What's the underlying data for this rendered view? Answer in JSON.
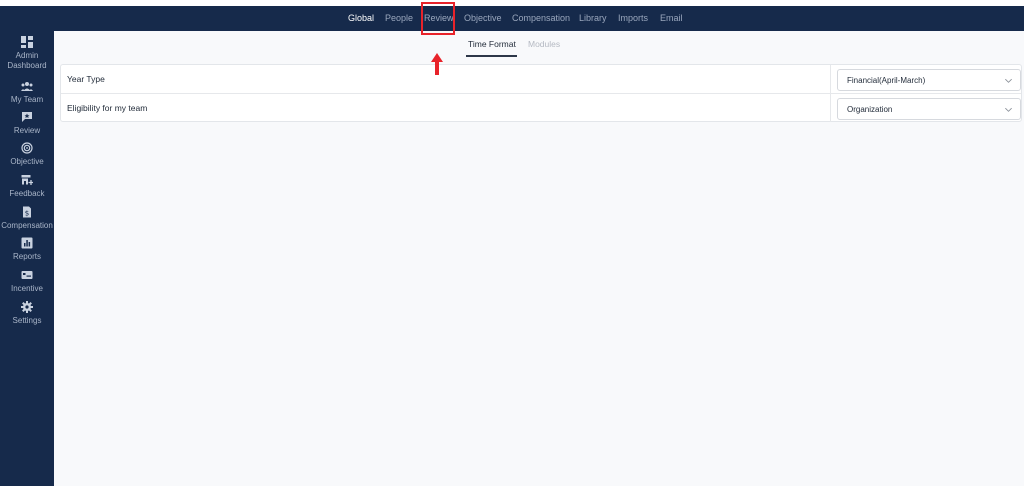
{
  "topnav": {
    "items": [
      {
        "label": "Global",
        "active": true
      },
      {
        "label": "People",
        "active": false
      },
      {
        "label": "Review",
        "active": false
      },
      {
        "label": "Objective",
        "active": false
      },
      {
        "label": "Compensation",
        "active": false
      },
      {
        "label": "Library",
        "active": false
      },
      {
        "label": "Imports",
        "active": false
      },
      {
        "label": "Email",
        "active": false
      }
    ]
  },
  "sidebar": {
    "items": [
      {
        "label": "Admin Dashboard",
        "line1": "Admin",
        "line2": "Dashboard",
        "icon": "dashboard-grid-icon"
      },
      {
        "label": "My Team",
        "icon": "team-icon"
      },
      {
        "label": "Review",
        "icon": "review-chat-icon"
      },
      {
        "label": "Objective",
        "icon": "target-icon"
      },
      {
        "label": "Feedback",
        "icon": "feedback-store-icon"
      },
      {
        "label": "Compensation",
        "icon": "dollar-doc-icon"
      },
      {
        "label": "Reports",
        "icon": "bar-chart-icon"
      },
      {
        "label": "Incentive",
        "icon": "card-icon"
      },
      {
        "label": "Settings",
        "icon": "gear-icon"
      }
    ]
  },
  "subtabs": {
    "items": [
      {
        "label": "Time Format",
        "active": true
      },
      {
        "label": "Modules",
        "active": false
      }
    ]
  },
  "settings": {
    "rows": [
      {
        "label": "Year Type",
        "value": "Financial(April-March)"
      },
      {
        "label": "Eligibility for my team",
        "value": "Organization"
      }
    ]
  },
  "colors": {
    "nav_bg": "#162a4b",
    "content_bg": "#f8f9fb",
    "highlight": "#e8232a"
  }
}
